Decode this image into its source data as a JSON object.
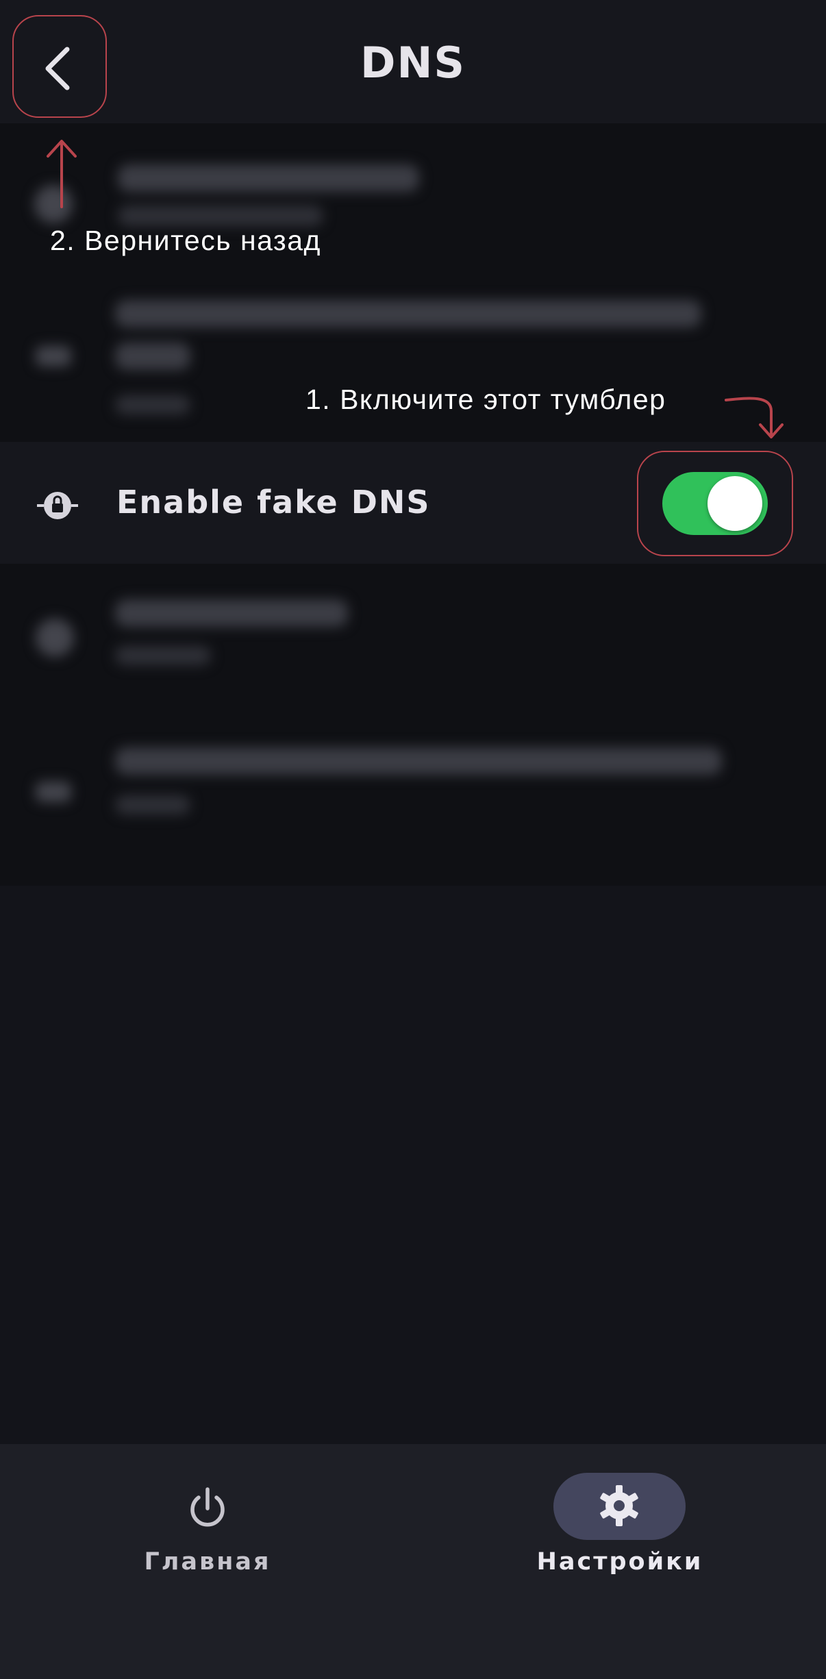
{
  "header": {
    "title": "DNS",
    "back_icon": "chevron-left-icon"
  },
  "settings_row": {
    "label": "Enable fake DNS",
    "icon": "lock-network-icon",
    "toggle_on": true
  },
  "annotations": {
    "toggle_hint": "1. Включите этот тумблер",
    "back_hint": "2. Вернитесь назад"
  },
  "bottom_nav": {
    "home_label": "Главная",
    "home_icon": "power-icon",
    "settings_label": "Настройки",
    "settings_icon": "gear-icon"
  },
  "colors": {
    "background": "#13141a",
    "highlight_border": "#b8444c",
    "toggle_on": "#30c15a",
    "nav_active_pill": "#44465e"
  }
}
